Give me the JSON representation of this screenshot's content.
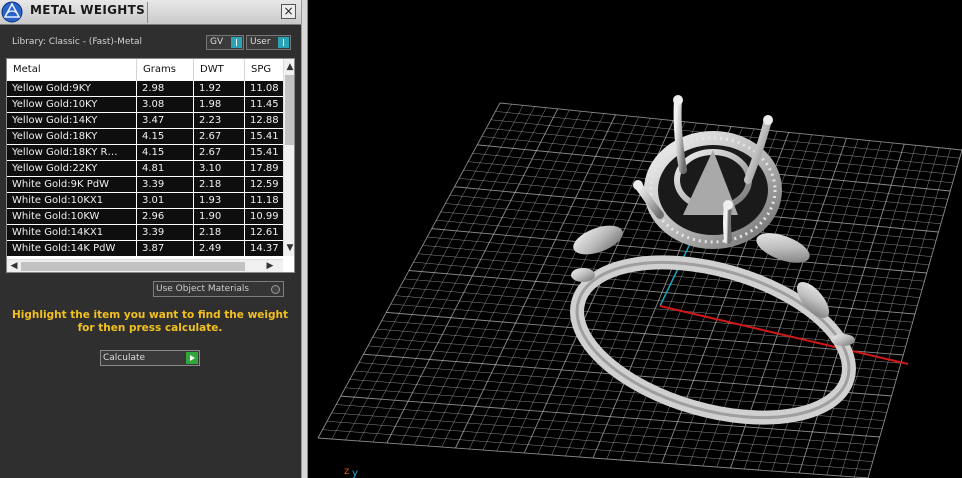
{
  "panel": {
    "title": "METAL WEIGHTS",
    "library_label": "Library: Classic - (Fast)-Metal",
    "toggles": [
      {
        "label": "GV"
      },
      {
        "label": "User"
      }
    ],
    "columns": [
      "Metal",
      "Grams",
      "DWT",
      "SPG"
    ],
    "rows": [
      {
        "metal": "Yellow Gold:9KY",
        "grams": "2.98",
        "dwt": "1.92",
        "spg": "11.08"
      },
      {
        "metal": "Yellow Gold:10KY",
        "grams": "3.08",
        "dwt": "1.98",
        "spg": "11.45"
      },
      {
        "metal": "Yellow Gold:14KY",
        "grams": "3.47",
        "dwt": "2.23",
        "spg": "12.88"
      },
      {
        "metal": "Yellow Gold:18KY",
        "grams": "4.15",
        "dwt": "2.67",
        "spg": "15.41"
      },
      {
        "metal": "Yellow Gold:18KY R…",
        "grams": "4.15",
        "dwt": "2.67",
        "spg": "15.41"
      },
      {
        "metal": "Yellow Gold:22KY",
        "grams": "4.81",
        "dwt": "3.10",
        "spg": "17.89"
      },
      {
        "metal": "White Gold:9K PdW",
        "grams": "3.39",
        "dwt": "2.18",
        "spg": "12.59"
      },
      {
        "metal": "White Gold:10KX1",
        "grams": "3.01",
        "dwt": "1.93",
        "spg": "11.18"
      },
      {
        "metal": "White Gold:10KW",
        "grams": "2.96",
        "dwt": "1.90",
        "spg": "10.99"
      },
      {
        "metal": "White Gold:14KX1",
        "grams": "3.39",
        "dwt": "2.18",
        "spg": "12.61"
      },
      {
        "metal": "White Gold:14K PdW",
        "grams": "3.87",
        "dwt": "2.49",
        "spg": "14.37"
      }
    ],
    "use_object_materials": "Use Object Materials",
    "message": "Highlight the item you want to find the weight for then press calculate.",
    "calculate_label": "Calculate"
  },
  "viewport": {
    "axis_label_z": "z",
    "axis_label_y": "y",
    "colors": {
      "grid": "#b8b8b8",
      "x_axis": "#d01818",
      "y_axis": "#1aa6c4",
      "model": "#c8c8c8"
    },
    "model_icon": "ring-model"
  }
}
